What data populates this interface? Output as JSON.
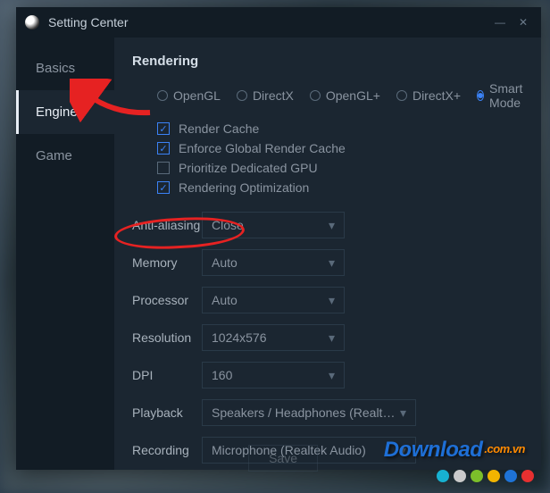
{
  "window": {
    "title": "Setting Center"
  },
  "sidebar": {
    "items": [
      {
        "label": "Basics"
      },
      {
        "label": "Engine"
      },
      {
        "label": "Game"
      }
    ]
  },
  "rendering": {
    "section_title": "Rendering",
    "modes": {
      "opengl": "OpenGL",
      "directx": "DirectX",
      "opengl_plus": "OpenGL+",
      "directx_plus": "DirectX+",
      "smart": "Smart Mode"
    },
    "checks": {
      "render_cache": "Render Cache",
      "enforce_global": "Enforce Global Render Cache",
      "prioritize_gpu": "Prioritize Dedicated GPU",
      "render_opt": "Rendering Optimization"
    }
  },
  "form": {
    "anti_alias": {
      "label": "Anti-aliasing",
      "value": "Close"
    },
    "memory": {
      "label": "Memory",
      "value": "Auto"
    },
    "processor": {
      "label": "Processor",
      "value": "Auto"
    },
    "resolution": {
      "label": "Resolution",
      "value": "1024x576"
    },
    "dpi": {
      "label": "DPI",
      "value": "160"
    },
    "playback": {
      "label": "Playback",
      "value": "Speakers / Headphones (Realtek Audio)"
    },
    "recording": {
      "label": "Recording",
      "value": "Microphone (Realtek Audio)"
    }
  },
  "buttons": {
    "save": "Save"
  },
  "watermark": {
    "main": "Download",
    "ext": ".com.vn"
  },
  "dot_colors": [
    "#17b1d1",
    "#cacaca",
    "#7cbf2a",
    "#f2b400",
    "#1e73d6",
    "#e63030"
  ]
}
